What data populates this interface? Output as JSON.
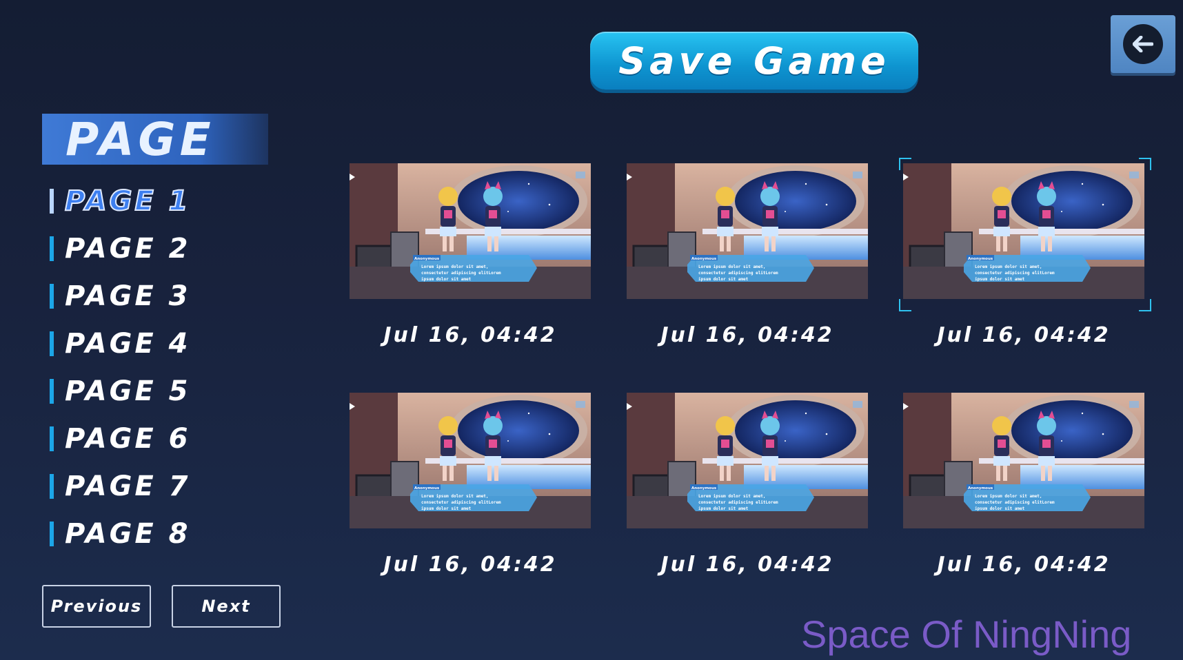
{
  "header": {
    "title": "Save Game"
  },
  "sidebar": {
    "heading": "PAGE",
    "pages": [
      {
        "label": "PAGE 1",
        "active": true
      },
      {
        "label": "PAGE 2",
        "active": false
      },
      {
        "label": "PAGE 3",
        "active": false
      },
      {
        "label": "PAGE 4",
        "active": false
      },
      {
        "label": "PAGE 5",
        "active": false
      },
      {
        "label": "PAGE 6",
        "active": false
      },
      {
        "label": "PAGE 7",
        "active": false
      },
      {
        "label": "PAGE 8",
        "active": false
      }
    ],
    "previous_label": "Previous",
    "next_label": "Next"
  },
  "slots": [
    {
      "time": "Jul 16, 04:42",
      "selected": false
    },
    {
      "time": "Jul 16, 04:42",
      "selected": false
    },
    {
      "time": "Jul 16, 04:42",
      "selected": true
    },
    {
      "time": "Jul 16, 04:42",
      "selected": false
    },
    {
      "time": "Jul 16, 04:42",
      "selected": false
    },
    {
      "time": "Jul 16, 04:42",
      "selected": false
    }
  ],
  "thumbnail_dialog": {
    "speaker": "Anonymous",
    "lines": [
      "Lorem ipsum dolor sit amet,",
      "consectetur adipiscing elitLorem",
      "ipsum dolor sit amet"
    ]
  },
  "watermark": "Space Of NingNing",
  "icons": {
    "back": "back-arrow-icon"
  },
  "colors": {
    "accent": "#1ca6e8",
    "active_page": "#3d7ff0",
    "selection": "#2fc2ef"
  }
}
